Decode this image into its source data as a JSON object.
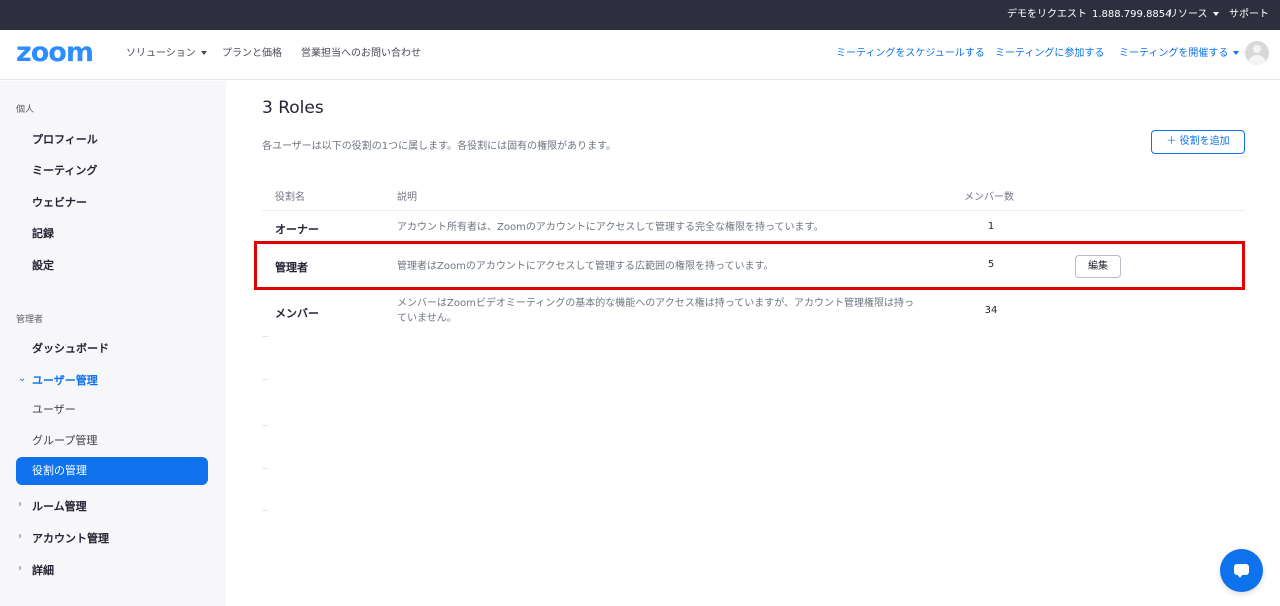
{
  "topbar": {
    "request_demo": "デモをリクエスト",
    "phone": "1.888.799.8854",
    "resources": "リソース",
    "support": "サポート"
  },
  "navbar": {
    "logo": "zoom",
    "solutions": "ソリューション",
    "plans": "プランと価格",
    "contact_sales": "営業担当へのお問い合わせ",
    "schedule": "ミーティングをスケジュールする",
    "join": "ミーティングに参加する",
    "host": "ミーティングを開催する"
  },
  "sidebar": {
    "personal_section": "個人",
    "personal_items": [
      "プロフィール",
      "ミーティング",
      "ウェビナー",
      "記録",
      "設定"
    ],
    "admin_section": "管理者",
    "dashboard": "ダッシュボード",
    "user_management": "ユーザー管理",
    "users": "ユーザー",
    "group_management": "グループ管理",
    "role_management": "役割の管理",
    "room_management": "ルーム管理",
    "account_management": "アカウント管理",
    "advanced": "詳細"
  },
  "main": {
    "title": "3 Roles",
    "description": "各ユーザーは以下の役割の1つに属します。各役割には固有の権限があります。",
    "add_role": "役割を追加",
    "columns": {
      "name": "役割名",
      "description": "説明",
      "members": "メンバー数"
    },
    "rows": [
      {
        "name": "オーナー",
        "description": "アカウント所有者は、Zoomのアカウントにアクセスして管理する完全な権限を持っています。",
        "members": "1"
      },
      {
        "name": "管理者",
        "description": "管理者はZoomのアカウントにアクセスして管理する広範囲の権限を持っています。",
        "members": "5",
        "action": "編集"
      },
      {
        "name": "メンバー",
        "description": "メンバーはZoomビデオミーティングの基本的な機能へのアクセス権は持っていますが、アカウント管理権限は持っていません。",
        "members": "34"
      }
    ]
  },
  "colors": {
    "accent": "#0e72ed",
    "topbar": "#2d2f3f",
    "highlight": "#e00000"
  }
}
